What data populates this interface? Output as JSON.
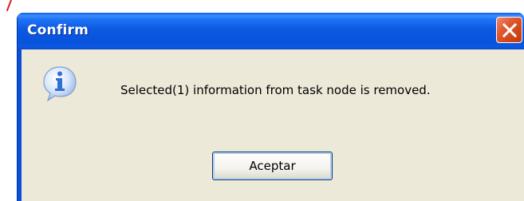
{
  "dialog": {
    "title": "Confirm",
    "message": "Selected(1) information from task node is removed.",
    "ok_label": "Aceptar",
    "icon": "information-icon",
    "close_icon": "close-icon"
  },
  "colors": {
    "titlebar": "#0a4fd8",
    "close_button": "#d04618",
    "body": "#ece9d8",
    "icon_blue": "#2f6fd6",
    "annotation_red": "#e02020"
  }
}
